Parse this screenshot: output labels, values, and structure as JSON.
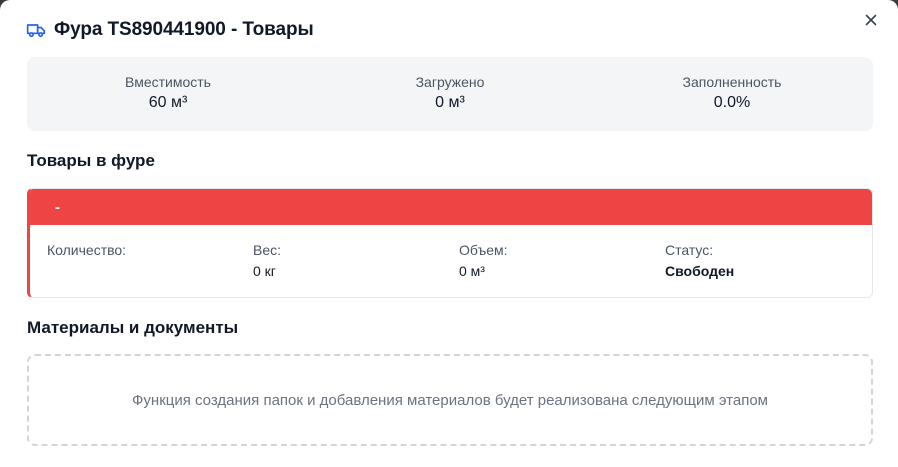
{
  "modal": {
    "title": "Фура TS890441900 - Товары",
    "icons": {
      "title": "truck-icon",
      "close": "close-icon"
    }
  },
  "stats": [
    {
      "label": "Вместимость",
      "value": "60 м³"
    },
    {
      "label": "Загружено",
      "value": "0 м³"
    },
    {
      "label": "Заполненность",
      "value": "0.0%"
    }
  ],
  "goods_section": {
    "title": "Товары в фуре",
    "item": {
      "name": "-",
      "fields": [
        {
          "label": "Количество:",
          "value": ""
        },
        {
          "label": "Вес:",
          "value": "0 кг"
        },
        {
          "label": "Объем:",
          "value": "0 м³"
        },
        {
          "label": "Статус:",
          "value": "Свободен"
        }
      ]
    }
  },
  "materials_section": {
    "title": "Материалы и документы",
    "placeholder": "Функция создания папок и добавления материалов будет реализована следующим этапом"
  },
  "colors": {
    "accent_blue": "#2563eb",
    "status_red": "#ef4444",
    "panel_bg": "#f4f5f7"
  }
}
